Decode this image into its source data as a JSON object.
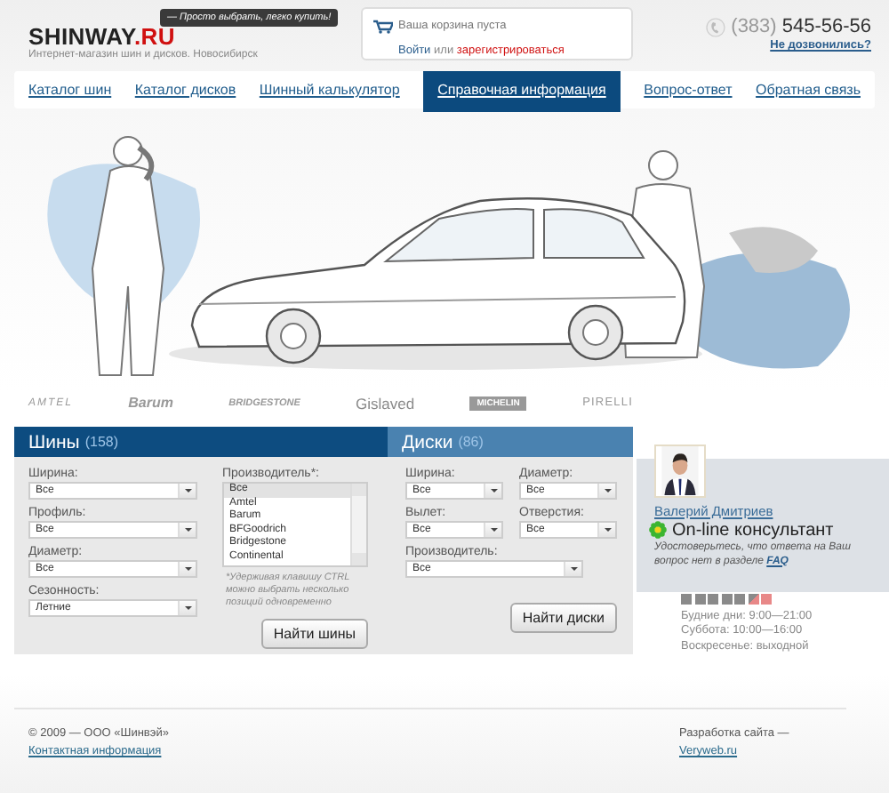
{
  "header": {
    "logo_main": "SHINWAY",
    "logo_suffix": ".RU",
    "tagline": "— Просто выбрать, легко купить!",
    "subtitle": "Интернет-магазин шин и дисков. Новосибирск"
  },
  "cart": {
    "status": "Ваша корзина пуста",
    "login": "Войти",
    "or": "или",
    "register": "зарегистрироваться"
  },
  "phone": {
    "code": "(383)",
    "number": "545-56-56",
    "callback": "Не дозвонились?"
  },
  "nav": [
    {
      "label": "Каталог шин",
      "selected": false
    },
    {
      "label": "Каталог дисков",
      "selected": false
    },
    {
      "label": "Шинный калькулятор",
      "selected": false
    },
    {
      "label": "Справочная информация",
      "selected": true
    },
    {
      "label": "Вопрос-ответ",
      "selected": false
    },
    {
      "label": "Обратная связь",
      "selected": false
    }
  ],
  "brands": [
    "AMTEL",
    "Barum",
    "BRIDGESTONE",
    "Gislaved",
    "MICHELIN",
    "PIRELLI"
  ],
  "tyres": {
    "title": "Шины",
    "count": "(158)",
    "fields": [
      {
        "label": "Ширина:",
        "value": "Все"
      },
      {
        "label": "Профиль:",
        "value": "Все"
      },
      {
        "label": "Диаметр:",
        "value": "Все"
      },
      {
        "label": "Сезонность:",
        "value": "Летние"
      }
    ],
    "maker": {
      "label": "Производитель*:",
      "options": [
        {
          "text": "Все",
          "selected": true
        },
        {
          "text": "Amtel",
          "selected": false
        },
        {
          "text": "Barum",
          "selected": false
        },
        {
          "text": "BFGoodrich",
          "selected": false
        },
        {
          "text": "Bridgestone",
          "selected": false
        },
        {
          "text": "Continental",
          "selected": false
        }
      ]
    },
    "note": "*Удерживая клавишу CTRL можно выбрать несколько позиций одновременно",
    "button": "Найти шины"
  },
  "disks": {
    "title": "Диски",
    "count": "(86)",
    "fields": [
      {
        "label": "Ширина:",
        "value": "Все"
      },
      {
        "label": "Диаметр:",
        "value": "Все"
      },
      {
        "label": "Вылет:",
        "value": "Все"
      },
      {
        "label": "Отверстия:",
        "value": "Все"
      }
    ],
    "maker": {
      "label": "Производитель:",
      "value": "Все"
    },
    "button": "Найти диски"
  },
  "consultant": {
    "name": "Валерий Дмитриев",
    "title": "On-line консультант",
    "note": "Удостоверьтесь, что ответа на Ваш вопрос нет в разделе",
    "faq": "FAQ"
  },
  "hours": [
    "Будние дни: 9:00—21:00",
    "Суббота: 10:00—16:00",
    "Воскресенье: выходной"
  ],
  "footer": {
    "copyright": "© 2009 — ООО «Шинвэй»",
    "contacts": "Контактная информация",
    "dev": "Разработка сайта —",
    "dev_link": "Veryweb.ru"
  }
}
